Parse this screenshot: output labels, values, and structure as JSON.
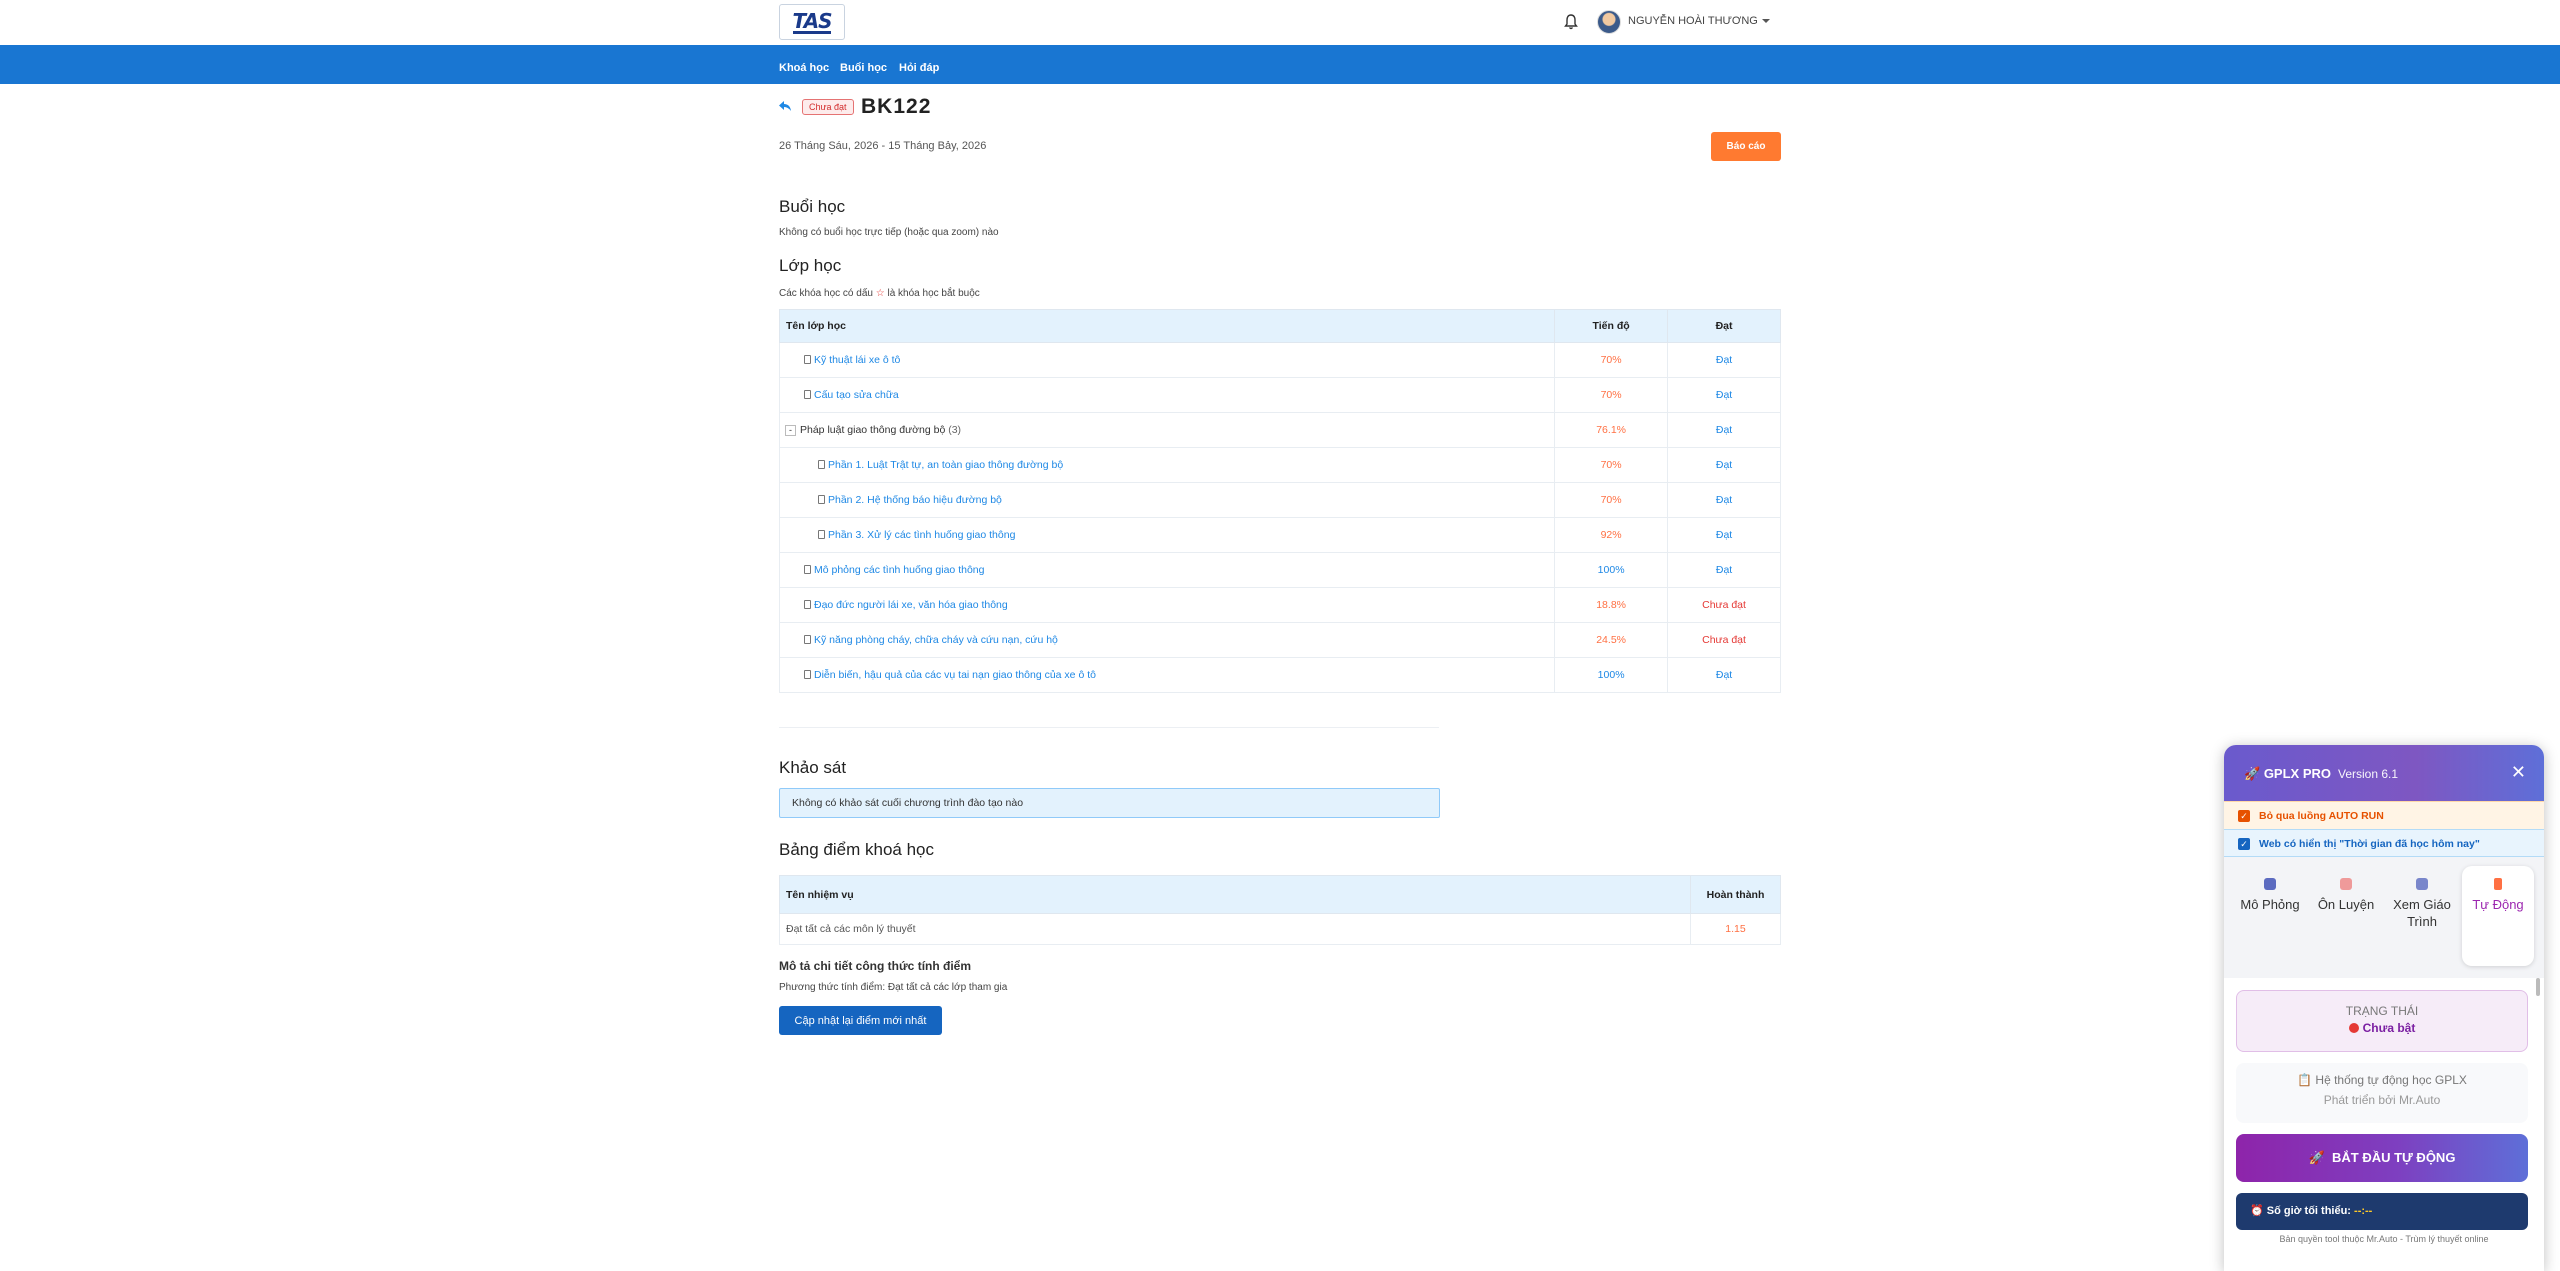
{
  "header": {
    "logo_text": "TAS",
    "username": "NGUYỄN HOÀI THƯƠNG"
  },
  "nav": {
    "items": [
      "Khoá học",
      "Buổi học",
      "Hỏi đáp"
    ]
  },
  "course": {
    "status_badge": "Chưa đạt",
    "title": "BK122",
    "date_range": "26 Tháng Sáu, 2026 - 15 Tháng Bảy, 2026",
    "report_button": "Báo cáo"
  },
  "sessions": {
    "heading": "Buổi học",
    "empty_text": "Không có buổi học trực tiếp (hoặc qua zoom) nào"
  },
  "classes": {
    "heading": "Lớp học",
    "note_before": "Các khóa học có dấu ",
    "note_star": "☆",
    "note_after": " là khóa học bắt buộc",
    "columns": [
      "Tên lớp học",
      "Tiến độ",
      "Đạt"
    ],
    "rows": [
      {
        "name": "Kỹ thuật lái xe ô tô",
        "progress": "70%",
        "result": "Đạt"
      },
      {
        "name": "Cấu tạo sửa chữa",
        "progress": "70%",
        "result": "Đạt"
      },
      {
        "name": "Pháp luật giao thông đường bộ",
        "count": "(3)",
        "toggle": "-",
        "progress": "76.1%",
        "result": "Đạt"
      },
      {
        "name": "Phần 1. Luật Trật tự, an toàn giao thông đường bộ",
        "progress": "70%",
        "result": "Đạt"
      },
      {
        "name": "Phần 2. Hệ thống báo hiệu đường bộ",
        "progress": "70%",
        "result": "Đạt"
      },
      {
        "name": "Phần 3. Xử lý các tình huống giao thông",
        "progress": "92%",
        "result": "Đạt"
      },
      {
        "name": "Mô phỏng các tình huống giao thông",
        "progress": "100%",
        "result": "Đạt"
      },
      {
        "name": "Đạo đức người lái xe, văn hóa giao thông",
        "progress": "18.8%",
        "result": "Chưa đạt"
      },
      {
        "name": "Kỹ năng phòng cháy, chữa cháy và cứu nạn, cứu hộ",
        "progress": "24.5%",
        "result": "Chưa đạt"
      },
      {
        "name": "Diễn biến, hậu quả của các vụ tai nạn giao thông của xe ô tô",
        "progress": "100%",
        "result": "Đạt"
      }
    ]
  },
  "survey": {
    "heading": "Khảo sát",
    "empty_text": "Không có khảo sát cuối chương trình đào tạo nào"
  },
  "scores": {
    "heading": "Bảng điểm khoá học",
    "columns": [
      "Tên nhiệm vụ",
      "Hoàn thành"
    ],
    "rows": [
      {
        "task": "Đạt tất cả các môn lý thuyết",
        "done": "1.15"
      }
    ],
    "formula_title": "Mô tả chi tiết công thức tính điểm",
    "formula_text": "Phương thức tính điểm: Đạt tất cả các lớp tham gia",
    "update_button": "Cập nhật lại điểm mới nhất"
  },
  "extension": {
    "brand": "GPLX PRO",
    "version": "Version 6.1",
    "option_1": "Bỏ qua luồng AUTO RUN",
    "option_2": "Web có hiển thị \"Thời gian đã học hôm nay\"",
    "tabs": [
      {
        "label": "Mô Phỏng",
        "icon": "simulation-icon"
      },
      {
        "label": "Ôn Luyện",
        "icon": "practice-icon"
      },
      {
        "label": "Xem Giáo Trình",
        "icon": "book-icon"
      },
      {
        "label": "Tự Động",
        "icon": "lightning-icon"
      }
    ],
    "status_label": "TRẠNG THÁI",
    "status_value": "Chưa bật",
    "system_title": "Hệ thống tự động học GPLX",
    "developer": "Phát triển bởi Mr.Auto",
    "start_button": "BẮT ĐẦU TỰ ĐỘNG",
    "min_hours_label": "Số giờ tối thiểu:",
    "min_hours_value": "--:--",
    "copyright": "Bản quyền tool thuộc Mr.Auto - Trùm lý thuyết online",
    "colors": {
      "accent": "#7e57c2",
      "danger": "#e53935",
      "navy": "#1e3a6e"
    }
  },
  "colors": {
    "nav": "#1976d2",
    "report": "#ff7a30",
    "update": "#1565c0"
  }
}
